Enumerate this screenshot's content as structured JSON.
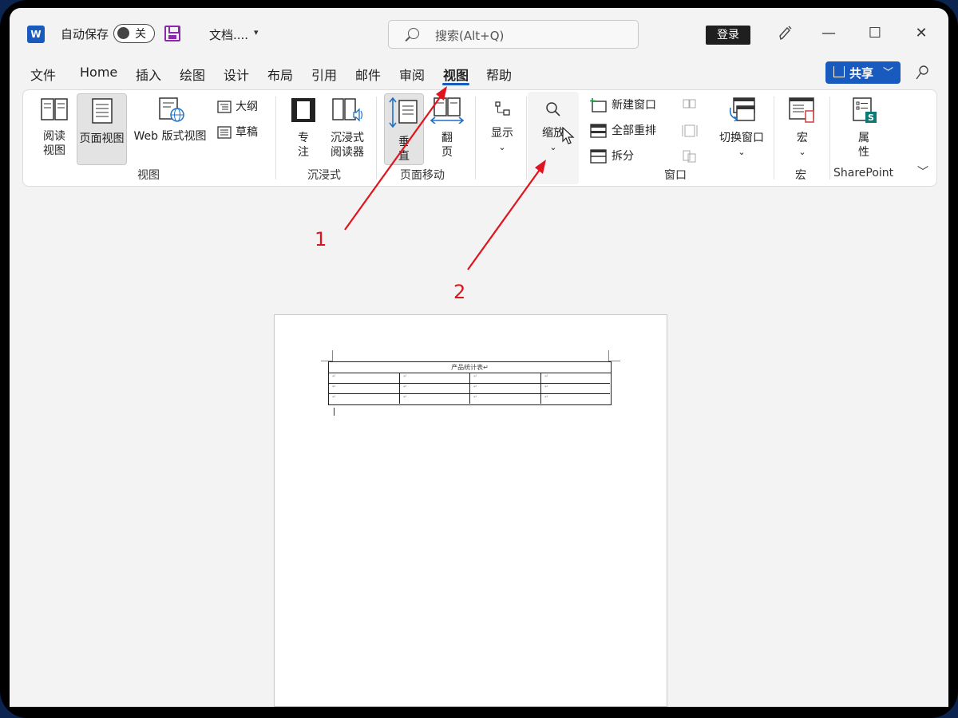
{
  "titlebar": {
    "autosave_label": "自动保存",
    "autosave_state": "关",
    "doc_title": "文档....",
    "search_placeholder": "搜索(Alt+Q)",
    "login_label": "登录"
  },
  "menu": {
    "tabs": [
      "文件",
      "Home",
      "插入",
      "绘图",
      "设计",
      "布局",
      "引用",
      "邮件",
      "审阅",
      "视图",
      "帮助"
    ],
    "active_tab": "视图",
    "share_label": "共享"
  },
  "ribbon": {
    "views": {
      "read_view": [
        "阅读",
        "视图"
      ],
      "print_layout": "页面视图",
      "web_layout": "Web 版式视图",
      "outline": "大纲",
      "draft": "草稿",
      "group_label": "视图"
    },
    "immersive": {
      "focus": [
        "专",
        "注"
      ],
      "immersive_reader": [
        "沉浸式",
        "阅读器"
      ],
      "group_label": "沉浸式"
    },
    "page_movement": {
      "vertical": [
        "垂",
        "直"
      ],
      "side_to_side": [
        "翻",
        "页"
      ],
      "group_label": "页面移动"
    },
    "show": {
      "label": "显示"
    },
    "zoom": {
      "label": "缩放"
    },
    "window": {
      "new_window": "新建窗口",
      "arrange_all": "全部重排",
      "split": "拆分",
      "switch_windows": "切换窗口",
      "group_label": "窗口"
    },
    "macros": {
      "label": "宏",
      "group_label": "宏"
    },
    "sharepoint": {
      "properties": [
        "属",
        "性"
      ],
      "group_label": "SharePoint"
    }
  },
  "document": {
    "table_title": "产品统计表",
    "cell_mark": "↵"
  },
  "annotations": [
    "1",
    "2"
  ],
  "colors": {
    "accent": "#185abd",
    "annotation": "#e0141e"
  }
}
